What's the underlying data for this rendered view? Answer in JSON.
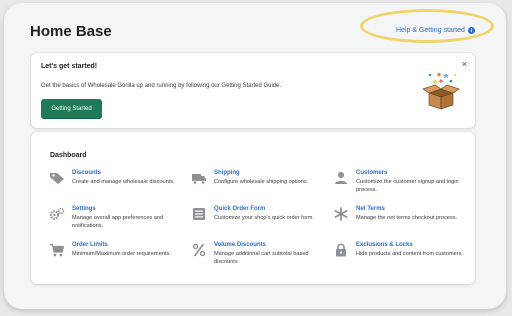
{
  "page": {
    "title": "Home Base"
  },
  "help": {
    "label": "Help & Getting started",
    "icon": "info-icon"
  },
  "getting_started": {
    "title": "Let's get started!",
    "description": "Get the basics of Wholesale Gorilla up and running by following our Getting Started Guide.",
    "button_label": "Getting Started",
    "close_label": "×",
    "illustration": "open-box-icon"
  },
  "dashboard": {
    "heading": "Dashboard",
    "items": [
      {
        "name": "Discounts",
        "text": "Create and manage wholesale discounts.",
        "icon": "tag-icon"
      },
      {
        "name": "Shipping",
        "text": "Configure wholesale shipping options.",
        "icon": "truck-icon"
      },
      {
        "name": "Customers",
        "text": "Customize the customer signup and login process.",
        "icon": "person-icon"
      },
      {
        "name": "Settings",
        "text": "Manage overall app preferences and notifications.",
        "icon": "gears-icon"
      },
      {
        "name": "Quick Order Form",
        "text": "Customize your shop's quick order form.",
        "icon": "list-icon"
      },
      {
        "name": "Net Terms",
        "text": "Manage the net terms checkout process.",
        "icon": "asterisk-icon"
      },
      {
        "name": "Order Limits",
        "text": "Minimum/Maximum order requirements.",
        "icon": "cart-icon"
      },
      {
        "name": "Volume Discounts",
        "text": "Manage additional cart subtotal based discounts",
        "icon": "percent-icon"
      },
      {
        "name": "Exclusions & Locks",
        "text": "Hide products and content from customers.",
        "icon": "lock-icon"
      }
    ]
  },
  "colors": {
    "link": "#2c6ecb",
    "button": "#1f7a57",
    "highlight": "#f0d46a",
    "icon": "#8c9196"
  }
}
